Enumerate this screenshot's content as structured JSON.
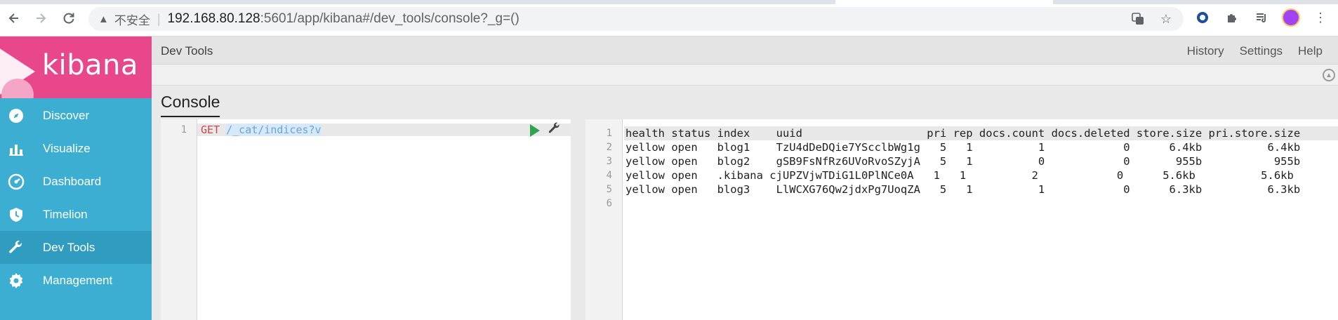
{
  "browser": {
    "insecure_label": "不安全",
    "url_host": "192.168.80.128",
    "url_path": ":5601/app/kibana#/dev_tools/console?_g=()"
  },
  "sidebar": {
    "logo_text": "kibana",
    "items": [
      {
        "label": "Discover",
        "icon": "compass-icon"
      },
      {
        "label": "Visualize",
        "icon": "bar-chart-icon"
      },
      {
        "label": "Dashboard",
        "icon": "gauge-icon"
      },
      {
        "label": "Timelion",
        "icon": "shield-icon"
      },
      {
        "label": "Dev Tools",
        "icon": "wrench-icon",
        "active": true
      },
      {
        "label": "Management",
        "icon": "gear-icon"
      }
    ]
  },
  "topnav": {
    "breadcrumb": "Dev Tools",
    "links": [
      "History",
      "Settings",
      "Help"
    ]
  },
  "console": {
    "title": "Console",
    "request": {
      "line_number": "1",
      "method": "GET",
      "url": "/_cat/indices?v"
    },
    "response": {
      "line_numbers": [
        "1",
        "2",
        "3",
        "4",
        "5",
        "6"
      ],
      "lines": [
        "health status index    uuid                   pri rep docs.count docs.deleted store.size pri.store.size",
        "yellow open   blog1    TzU4dDeDQie7YScclbWg1g   5   1          1            0      6.4kb          6.4kb",
        "yellow open   blog2    gSB9FsNfRz6UVoRvoSZyjA   5   1          0            0       955b           955b",
        "yellow open   .kibana cjUPZVjwTDiG1L0PlNCe0A   1   1          2            0      5.6kb          5.6kb",
        "yellow open   blog3    LlWCXG76Qw2jdxPg7UoqZA   5   1          1            0      6.3kb          6.3kb",
        ""
      ]
    }
  },
  "colors": {
    "sidebar_bg": "#3caed2",
    "logo_bg": "#e8488b",
    "active_item_bg": "#2f9cc0",
    "method_red": "#d0454b",
    "run_green": "#2ea44f"
  }
}
